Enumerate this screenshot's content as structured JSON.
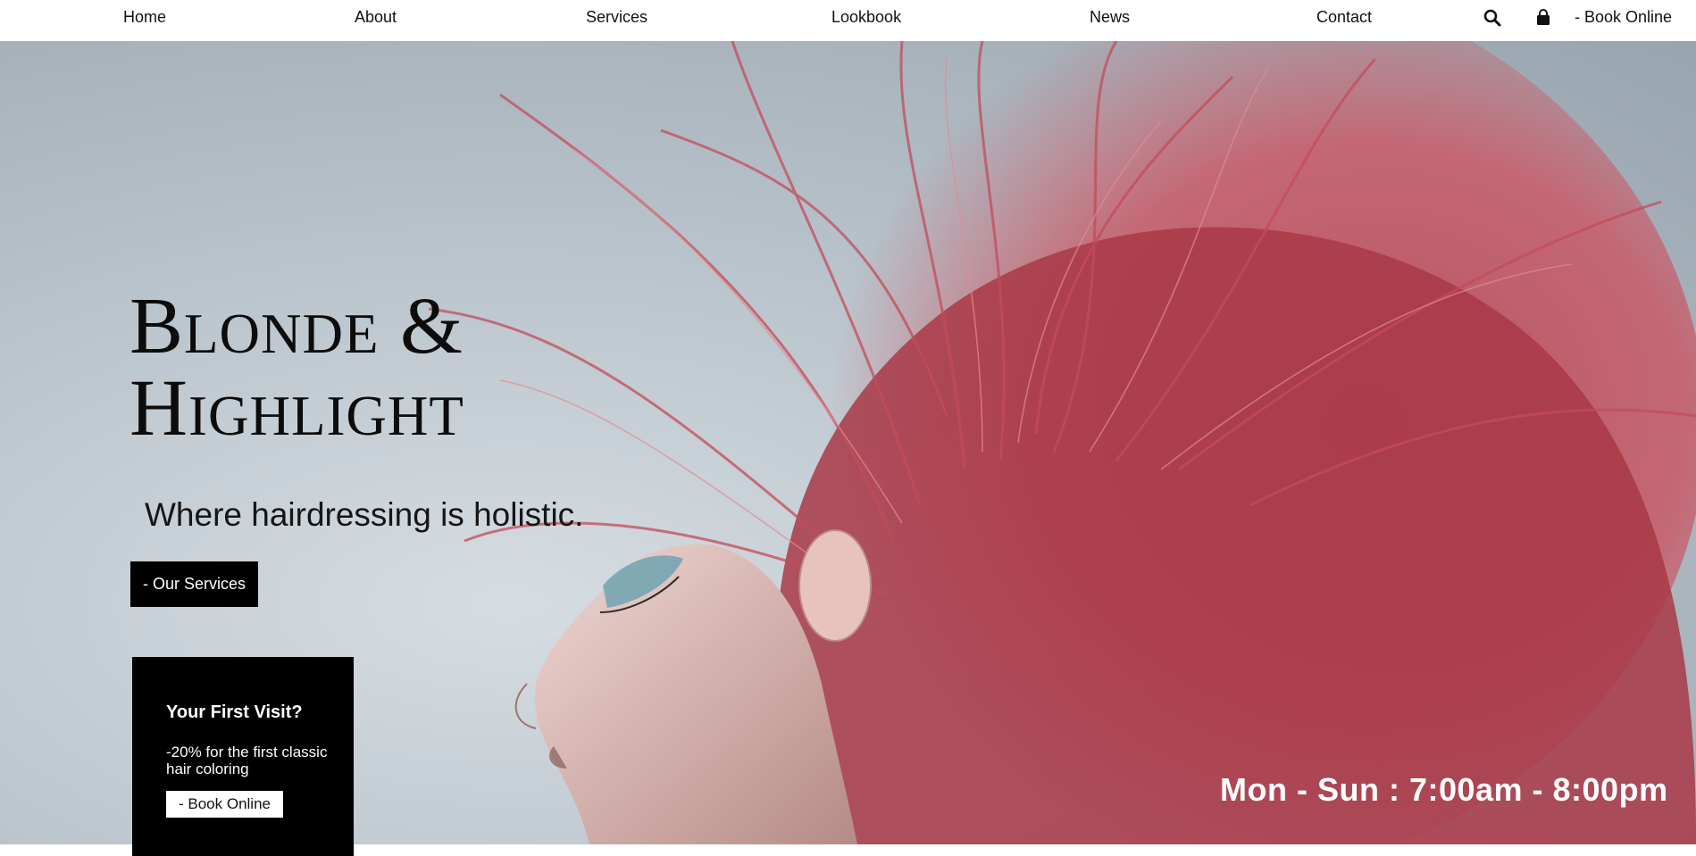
{
  "nav": {
    "links": [
      "Home",
      "About",
      "Services",
      "Lookbook",
      "News",
      "Contact"
    ],
    "search_icon": "search-icon",
    "bag_icon": "shopping-bag-icon",
    "book_label": "- Book Online"
  },
  "hero": {
    "title_line1": "Blonde &",
    "title_line2": "Highlight",
    "tagline": "Where hairdressing is holistic.",
    "services_button": "- Our Services",
    "hours": "Mon - Sun : 7:00am - 8:00pm"
  },
  "visit": {
    "title": "Your First Visit?",
    "text": "-20% for the first classic hair coloring",
    "button": "- Book Online"
  },
  "colors": {
    "nav_bg": "#ffffff",
    "button_bg": "#000000",
    "hair": "#c9515f",
    "hours_text": "#ffffff"
  }
}
